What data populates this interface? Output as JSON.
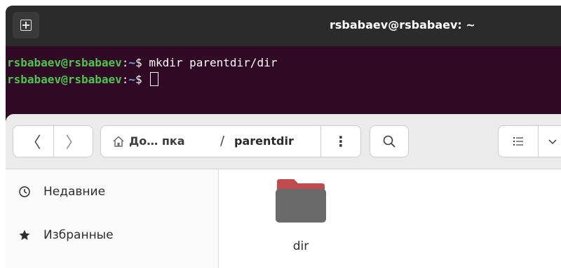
{
  "terminal": {
    "title": "rsbabaev@rsbabaev: ~",
    "lines": [
      {
        "user": "rsbabaev@rsbabaev",
        "sep": ":",
        "path": "~",
        "symbol": "$ ",
        "command": "mkdir parentdir/dir"
      },
      {
        "user": "rsbabaev@rsbabaev",
        "sep": ":",
        "path": "~",
        "symbol": "$ ",
        "command": ""
      }
    ],
    "new_tab_icon": "new-tab-icon",
    "colors": {
      "background": "#300a24",
      "user": "#4ec44e",
      "path": "#6fa6e8"
    }
  },
  "files": {
    "nav": {
      "back": "〈",
      "forward": "〉"
    },
    "breadcrumb": {
      "home": "До… пка",
      "separator": "/",
      "current": "parentdir"
    },
    "menu_label": "⋮",
    "sidebar": [
      {
        "label": "Недавние",
        "icon": "clock-icon"
      },
      {
        "label": "Избранные",
        "icon": "star-icon"
      }
    ],
    "items": [
      {
        "name": "dir",
        "icon": "folder-icon"
      }
    ],
    "colors": {
      "folder_tab": "#e0603a",
      "folder_body": "#6a6a6a"
    }
  }
}
